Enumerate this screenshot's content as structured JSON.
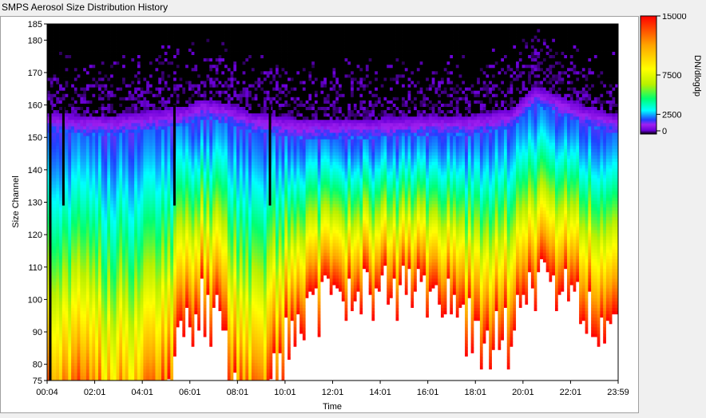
{
  "window": {
    "title": "SMPS Aerosol Size Distribution History"
  },
  "chart_data": {
    "type": "heatmap",
    "xlabel": "Time",
    "ylabel": "Size Channel",
    "x_ticks": [
      "00:04",
      "02:01",
      "04:01",
      "06:01",
      "08:01",
      "10:01",
      "12:01",
      "14:01",
      "16:01",
      "18:01",
      "20:01",
      "22:01",
      "23:59"
    ],
    "y_ticks": [
      75,
      80,
      90,
      100,
      110,
      120,
      130,
      140,
      150,
      160,
      170,
      180,
      185
    ],
    "ylim": [
      75,
      185
    ],
    "xlim_hours": [
      0.067,
      23.983
    ],
    "colorbar": {
      "label": "DN/dlogdp",
      "ticks": [
        0,
        2500,
        7500,
        15000
      ],
      "tick_labels": [
        "0",
        "2500",
        "7500",
        "15000"
      ],
      "range": [
        0,
        15000
      ],
      "colors": [
        "#000000",
        "#6a00d8",
        "#a020f0",
        "#2040ff",
        "#00ffff",
        "#00ff70",
        "#b8f000",
        "#ffff00",
        "#ffa500",
        "#ff0000"
      ]
    },
    "profiles": [
      {
        "time": 0.0,
        "low": 8000,
        "top": 158
      },
      {
        "time": 1.5,
        "low": 7000,
        "top": 157
      },
      {
        "time": 3.0,
        "low": 6000,
        "top": 157
      },
      {
        "time": 5.0,
        "low": 7500,
        "top": 159
      },
      {
        "time": 6.0,
        "low": 16000,
        "top": 160
      },
      {
        "time": 6.5,
        "low": 22000,
        "top": 162
      },
      {
        "time": 7.3,
        "low": 16000,
        "top": 161
      },
      {
        "time": 7.8,
        "low": 9000,
        "top": 160
      },
      {
        "time": 8.5,
        "low": 7500,
        "top": 158
      },
      {
        "time": 9.5,
        "low": 9000,
        "top": 157
      },
      {
        "time": 10.5,
        "low": 18000,
        "top": 156
      },
      {
        "time": 12.0,
        "low": 24000,
        "top": 156
      },
      {
        "time": 14.0,
        "low": 26000,
        "top": 156
      },
      {
        "time": 16.0,
        "low": 25000,
        "top": 157
      },
      {
        "time": 17.5,
        "low": 20000,
        "top": 157
      },
      {
        "time": 18.0,
        "low": 15000,
        "top": 157
      },
      {
        "time": 19.5,
        "low": 15000,
        "top": 159
      },
      {
        "time": 20.5,
        "low": 24000,
        "top": 166
      },
      {
        "time": 21.5,
        "low": 26000,
        "top": 163
      },
      {
        "time": 22.5,
        "low": 20000,
        "top": 160
      },
      {
        "time": 23.98,
        "low": 16000,
        "top": 157
      }
    ],
    "gap_lines_hours": [
      0.2,
      0.75,
      5.4,
      9.4
    ]
  }
}
